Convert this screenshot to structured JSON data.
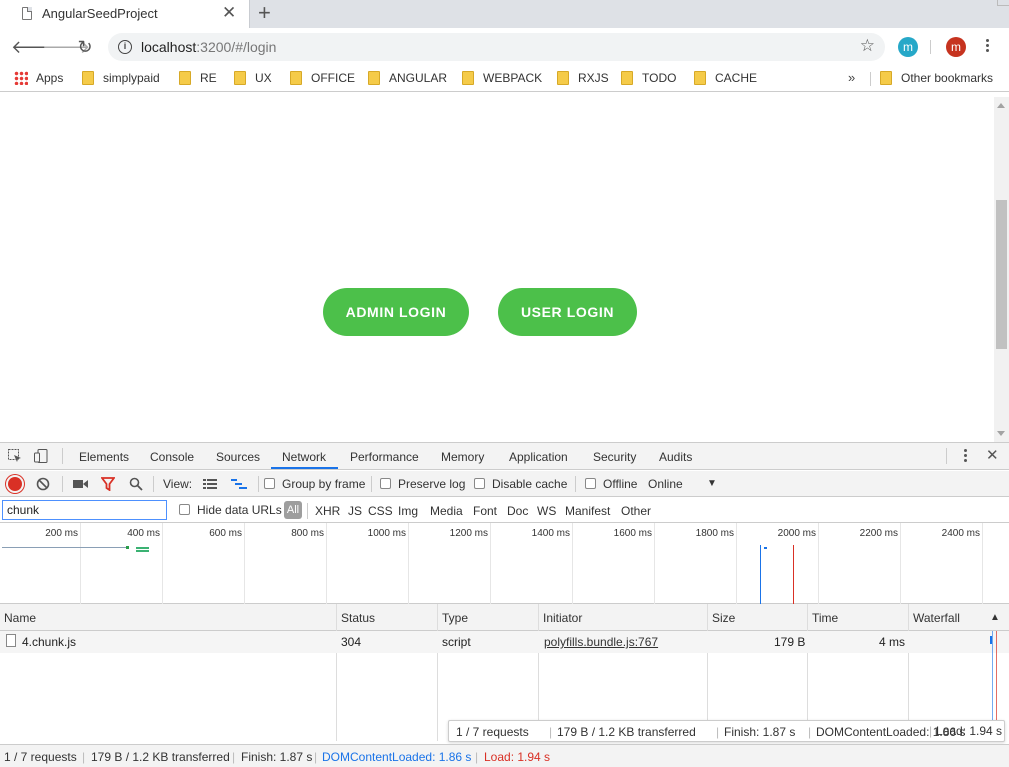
{
  "browser": {
    "tab": {
      "title": "AngularSeedProject"
    },
    "address": {
      "host": "localhost",
      "rest": ":3200/#/login"
    },
    "profile_ext_letter": "m",
    "profile_letter": "m",
    "colors": {
      "ext_avatar": "#26a8c8",
      "profile_avatar": "#c6331f"
    },
    "bookmarks": [
      {
        "label": "Apps",
        "kind": "apps"
      },
      {
        "label": "simplypaid",
        "kind": "folder"
      },
      {
        "label": "RE",
        "kind": "folder"
      },
      {
        "label": "UX",
        "kind": "folder"
      },
      {
        "label": "OFFICE",
        "kind": "folder"
      },
      {
        "label": "ANGULAR",
        "kind": "folder"
      },
      {
        "label": "WEBPACK",
        "kind": "folder"
      },
      {
        "label": "RXJS",
        "kind": "folder"
      },
      {
        "label": "TODO",
        "kind": "folder"
      },
      {
        "label": "CACHE",
        "kind": "folder"
      }
    ],
    "bookmarks_more": "»",
    "other_bookmarks": "Other bookmarks"
  },
  "page": {
    "admin_login": "ADMIN LOGIN",
    "user_login": "USER LOGIN",
    "button_color": "#4cc04a"
  },
  "devtools": {
    "tabs": [
      "Elements",
      "Console",
      "Sources",
      "Network",
      "Performance",
      "Memory",
      "Application",
      "Security",
      "Audits"
    ],
    "active_tab": "Network",
    "toolbar": {
      "view_label": "View:",
      "group_by_frame": "Group by frame",
      "preserve_log": "Preserve log",
      "disable_cache": "Disable cache",
      "offline": "Offline",
      "throttling": "Online"
    },
    "filter": {
      "value": "chunk",
      "hide_data_urls": "Hide data URLs",
      "all": "All",
      "types": [
        "XHR",
        "JS",
        "CSS",
        "Img",
        "Media",
        "Font",
        "Doc",
        "WS",
        "Manifest",
        "Other"
      ]
    },
    "overview_ticks": [
      "200 ms",
      "400 ms",
      "600 ms",
      "800 ms",
      "1000 ms",
      "1200 ms",
      "1400 ms",
      "1600 ms",
      "1800 ms",
      "2000 ms",
      "2200 ms",
      "2400 ms"
    ],
    "columns": [
      "Name",
      "Status",
      "Type",
      "Initiator",
      "Size",
      "Time",
      "Waterfall"
    ],
    "rows": [
      {
        "name": "4.chunk.js",
        "status": "304",
        "type": "script",
        "initiator": "polyfills.bundle.js:767",
        "size": "179 B",
        "time": "4 ms"
      }
    ],
    "summary": {
      "requests": "1 / 7 requests",
      "transferred": "179 B / 1.2 KB transferred",
      "finish_float": "Finish: 1.87 s",
      "finish": "Finish: 1.87 s",
      "dcl": "DOMContentLoaded: 1.86 s",
      "load": "Load: 1.94 s"
    },
    "colors": {
      "dcl": "#1a73e8",
      "load": "#d93025",
      "record": "#d93025"
    }
  }
}
